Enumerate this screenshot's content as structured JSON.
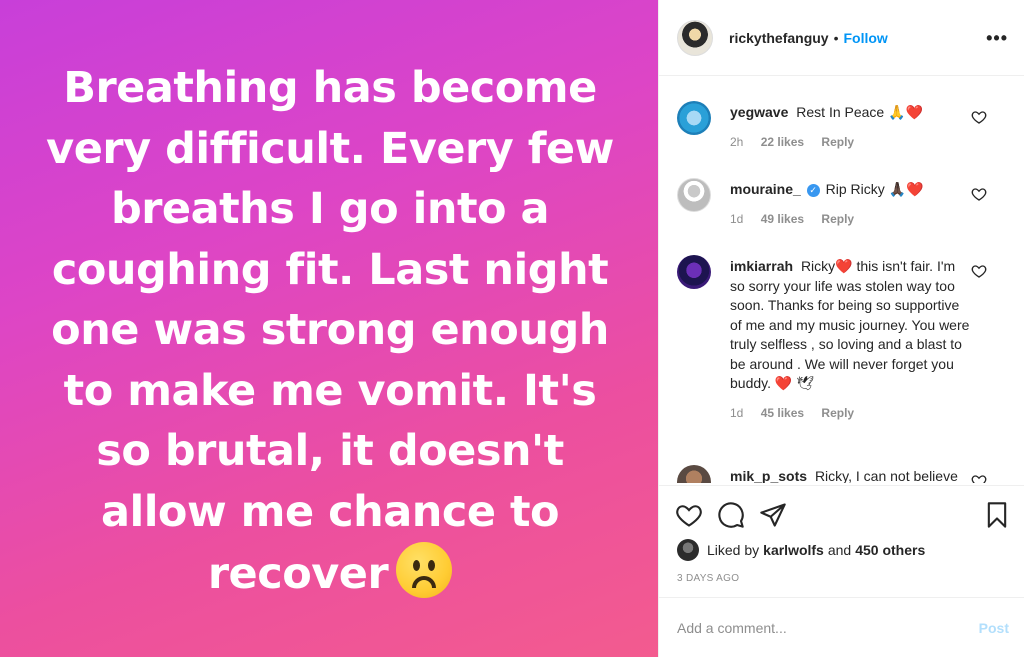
{
  "story": {
    "lines": [
      "Breathing has become",
      "very difficult. Every few",
      "breaths I go into a",
      "coughing fit. Last night",
      "one was strong enough",
      "to make me vomit. It's",
      "so brutal, it doesn't",
      "allow me chance to",
      "recover"
    ],
    "emoji": "sad-face-emoji",
    "gradient": [
      "#c83fd9",
      "#f35b8f"
    ]
  },
  "header": {
    "username": "rickythefanguy",
    "dot": "•",
    "follow_label": "Follow",
    "more_label": "•••"
  },
  "comments": [
    {
      "user": "yegwave",
      "text": "Rest In Peace 🙏❤️",
      "time": "2h",
      "likes": "22 likes",
      "reply": "Reply"
    },
    {
      "user": "mouraine_",
      "verified": true,
      "text": "Rip Ricky 🙏🏿❤️",
      "time": "1d",
      "likes": "49 likes",
      "reply": "Reply"
    },
    {
      "user": "imkiarrah",
      "text": "Ricky❤️  this isn't fair. I'm so sorry your life was stolen way too soon. Thanks for being so supportive of me and my music journey. You were truly selfless , so loving and a blast to be around . We will never forget you buddy. ❤️ 🕊",
      "time": "1d",
      "likes": "45 likes",
      "reply": "Reply"
    },
    {
      "user": "mik_p_sots",
      "text": "Ricky, I can not believe"
    }
  ],
  "likes": {
    "prefix": "Liked by",
    "user": "karlwolfs",
    "and": "and",
    "others": "450 others"
  },
  "date": "3 DAYS AGO",
  "add_comment": {
    "placeholder": "Add a comment...",
    "post_label": "Post"
  },
  "colors": {
    "link_blue": "#0095f6",
    "post_disabled": "#b2dffc",
    "meta_gray": "#8e8e8e",
    "heart_red": "#e0245e"
  }
}
